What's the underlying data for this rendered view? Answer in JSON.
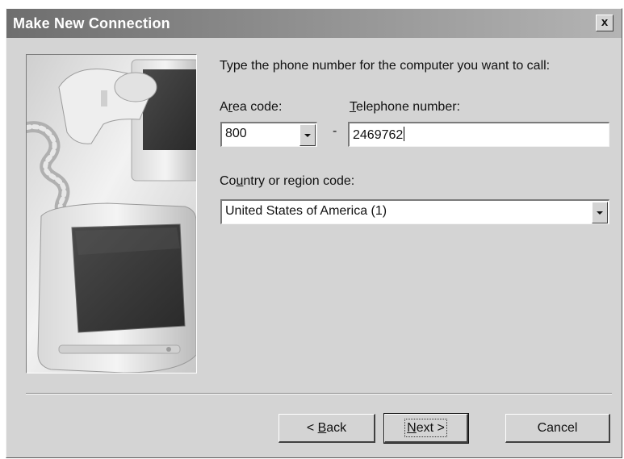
{
  "window": {
    "title": "Make New Connection",
    "close_glyph": "x"
  },
  "instructions": "Type the phone number for the computer you want to call:",
  "area_code": {
    "label_pre": "A",
    "label_mnemonic": "r",
    "label_post": "ea code:",
    "value": "800"
  },
  "dash": "-",
  "telephone": {
    "label_mnemonic": "T",
    "label_post": "elephone number:",
    "value": "2469762"
  },
  "country": {
    "label_pre": "Co",
    "label_mnemonic": "u",
    "label_post": "ntry or region code:",
    "value": "United States of America (1)"
  },
  "buttons": {
    "back_pre": "< ",
    "back_mnemonic": "B",
    "back_post": "ack",
    "next_mnemonic": "N",
    "next_post": "ext >",
    "cancel": "Cancel"
  },
  "icons": {
    "side_image": "computer-and-telephone-illustration",
    "dropdown": "chevron-down-icon",
    "close": "close-icon"
  },
  "colors": {
    "dialog_face": "#d4d4d4",
    "titlebar_start": "#6e6e6e",
    "titlebar_end": "#b4b4b4",
    "title_text": "#ffffff",
    "field_background": "#ffffff"
  }
}
